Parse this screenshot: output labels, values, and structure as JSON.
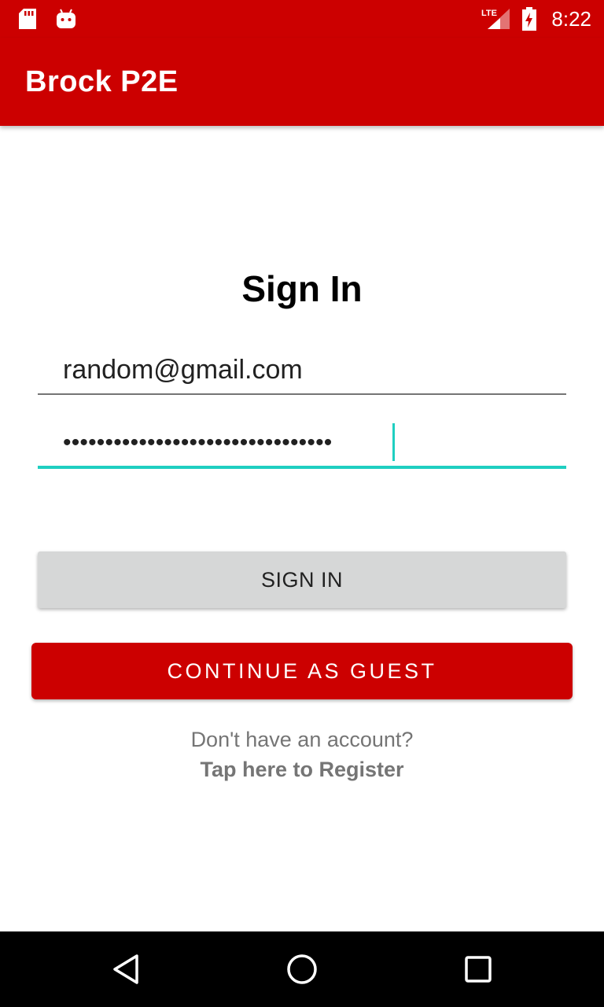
{
  "status_bar": {
    "time": "8:22",
    "network": "LTE",
    "icons": [
      "sd-card-icon",
      "android-icon",
      "lte-signal-icon",
      "battery-charging-icon"
    ]
  },
  "app_bar": {
    "title": "Brock P2E"
  },
  "form": {
    "heading": "Sign In",
    "email_value": "random@gmail.com",
    "password_masked": "••••••••••••••••••••••••••••••••",
    "signin_label": "SIGN IN",
    "guest_label": "CONTINUE AS GUEST",
    "prompt": "Don't have an account?",
    "register_label": "Tap here to Register"
  },
  "nav_bar": {
    "icons": [
      "back-icon",
      "home-icon",
      "recents-icon"
    ]
  },
  "colors": {
    "primary": "#cc0000",
    "accent": "#1fcfc1",
    "button_gray": "#d6d7d7"
  }
}
